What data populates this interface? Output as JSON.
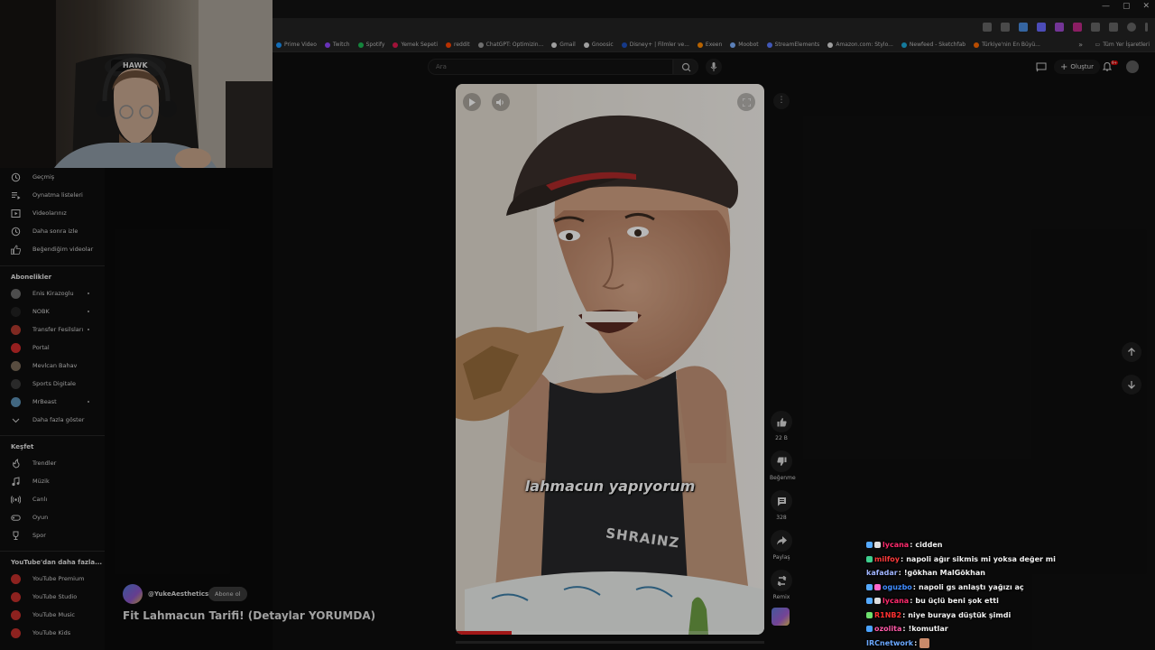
{
  "browser": {
    "window_controls": [
      "—",
      "▢",
      "✕"
    ],
    "bookmarks": [
      {
        "label": "Prime Video",
        "color": "#1a98ff"
      },
      {
        "label": "Twitch",
        "color": "#9146ff"
      },
      {
        "label": "Spotify",
        "color": "#1db954"
      },
      {
        "label": "Yemek Sepeti",
        "color": "#e01a4f"
      },
      {
        "label": "reddit",
        "color": "#ff4500"
      },
      {
        "label": "ChatGPT: Optimizin...",
        "color": "#9a9a9a"
      },
      {
        "label": "Gmail",
        "color": "#dddddd"
      },
      {
        "label": "Gnoosic",
        "color": "#dddddd"
      },
      {
        "label": "Disney+ | Filmler ve...",
        "color": "#1e4fbd"
      },
      {
        "label": "Exeen",
        "color": "#ff8a00"
      },
      {
        "label": "Moobot",
        "color": "#7fb2ff"
      },
      {
        "label": "StreamElements",
        "color": "#5a7bff"
      },
      {
        "label": "Amazon.com: Stylo...",
        "color": "#dddddd"
      },
      {
        "label": "Newfeed - Sketchfab",
        "color": "#1caad9"
      },
      {
        "label": "Türkiye'nin En Büyü...",
        "color": "#ff6a00"
      }
    ],
    "bookmarks_more": "»",
    "all_bookmarks": "Tüm Yer İşaretleri"
  },
  "masthead": {
    "search_placeholder": "Ara",
    "create_label": "Oluştur",
    "notification_count": "9+"
  },
  "sidebar": {
    "you_items": [
      {
        "label": "Geçmiş",
        "icon": "history-icon"
      },
      {
        "label": "Oynatma listeleri",
        "icon": "playlist-icon"
      },
      {
        "label": "Videolarınız",
        "icon": "your-videos-icon"
      },
      {
        "label": "Daha sonra izle",
        "icon": "watch-later-icon"
      },
      {
        "label": "Beğendiğim videolar",
        "icon": "liked-icon"
      }
    ],
    "subscriptions_heading": "Abonelikler",
    "subscriptions": [
      {
        "label": "Enis Kirazoglu",
        "color": "#6b6b6b",
        "live": true
      },
      {
        "label": "NOBK",
        "color": "#222222",
        "live": true
      },
      {
        "label": "Transfer Fesilsları",
        "color": "#b03a2e",
        "live": true
      },
      {
        "label": "Portal",
        "color": "#d02b2b",
        "live": false
      },
      {
        "label": "Mevlcan Bahav",
        "color": "#7a6a58",
        "live": false
      },
      {
        "label": "Sports Digitale",
        "color": "#3a3a3a",
        "live": false
      },
      {
        "label": "MrBeast",
        "color": "#5b8fb3",
        "live": true
      }
    ],
    "show_more": "Daha fazla göster",
    "explore_heading": "Keşfet",
    "explore_items": [
      {
        "label": "Trendler",
        "icon": "trending-icon"
      },
      {
        "label": "Müzik",
        "icon": "music-icon"
      },
      {
        "label": "Canlı",
        "icon": "live-icon"
      },
      {
        "label": "Oyun",
        "icon": "gaming-icon"
      },
      {
        "label": "Spor",
        "icon": "sports-icon"
      }
    ],
    "more_heading": "YouTube'dan daha fazla...",
    "more_items": [
      {
        "label": "YouTube Premium"
      },
      {
        "label": "YouTube Studio"
      },
      {
        "label": "YouTube Music"
      },
      {
        "label": "YouTube Kids"
      }
    ]
  },
  "webcam": {
    "headset_brand": "HAWK"
  },
  "short": {
    "caption": "lahmacun yapıyorum",
    "shirt_text": "SHRAINZ",
    "progress": 0.18,
    "channel": "@YukeAesthetics",
    "subscribe_label": "Abone ol",
    "title": "Fit Lahmacun Tarifi! (Detaylar YORUMDA)",
    "actions": {
      "like_count": "22 B",
      "dislike_label": "Beğenme",
      "comment_count": "328",
      "share_label": "Paylaş",
      "remix_label": "Remix"
    }
  },
  "chat": [
    {
      "user": "lycana",
      "color": "#ff2a6d",
      "text": "cidden",
      "badges": [
        "#55aaff",
        "#dddddd"
      ]
    },
    {
      "user": "milfoy",
      "color": "#ff3b3b",
      "text": "napoli ağır sikmis mi yoksa değer mi",
      "badges": [
        "#3ecf8e"
      ]
    },
    {
      "user": "kafadar",
      "color": "#9fb4ff",
      "text": "!gökhan MalGökhan",
      "badges": []
    },
    {
      "user": "oguzbo",
      "color": "#3f8cff",
      "text": "napoli gs anlaştı yağızı aç",
      "badges": [
        "#55aaff",
        "#ff66cc"
      ]
    },
    {
      "user": "lycana",
      "color": "#ff2a6d",
      "text": "bu üçlü beni şok etti",
      "badges": [
        "#55aaff",
        "#dddddd"
      ]
    },
    {
      "user": "R1NB2",
      "color": "#ff3030",
      "text": "niye buraya düştük şimdi",
      "badges": [
        "#6ee06e"
      ]
    },
    {
      "user": "ozolita",
      "color": "#ff5aa8",
      "text": "!komutlar",
      "badges": [
        "#4aa3ff"
      ]
    },
    {
      "user": "IRCnetwork",
      "color": "#6aa8ff",
      "text": "",
      "badges": []
    }
  ]
}
